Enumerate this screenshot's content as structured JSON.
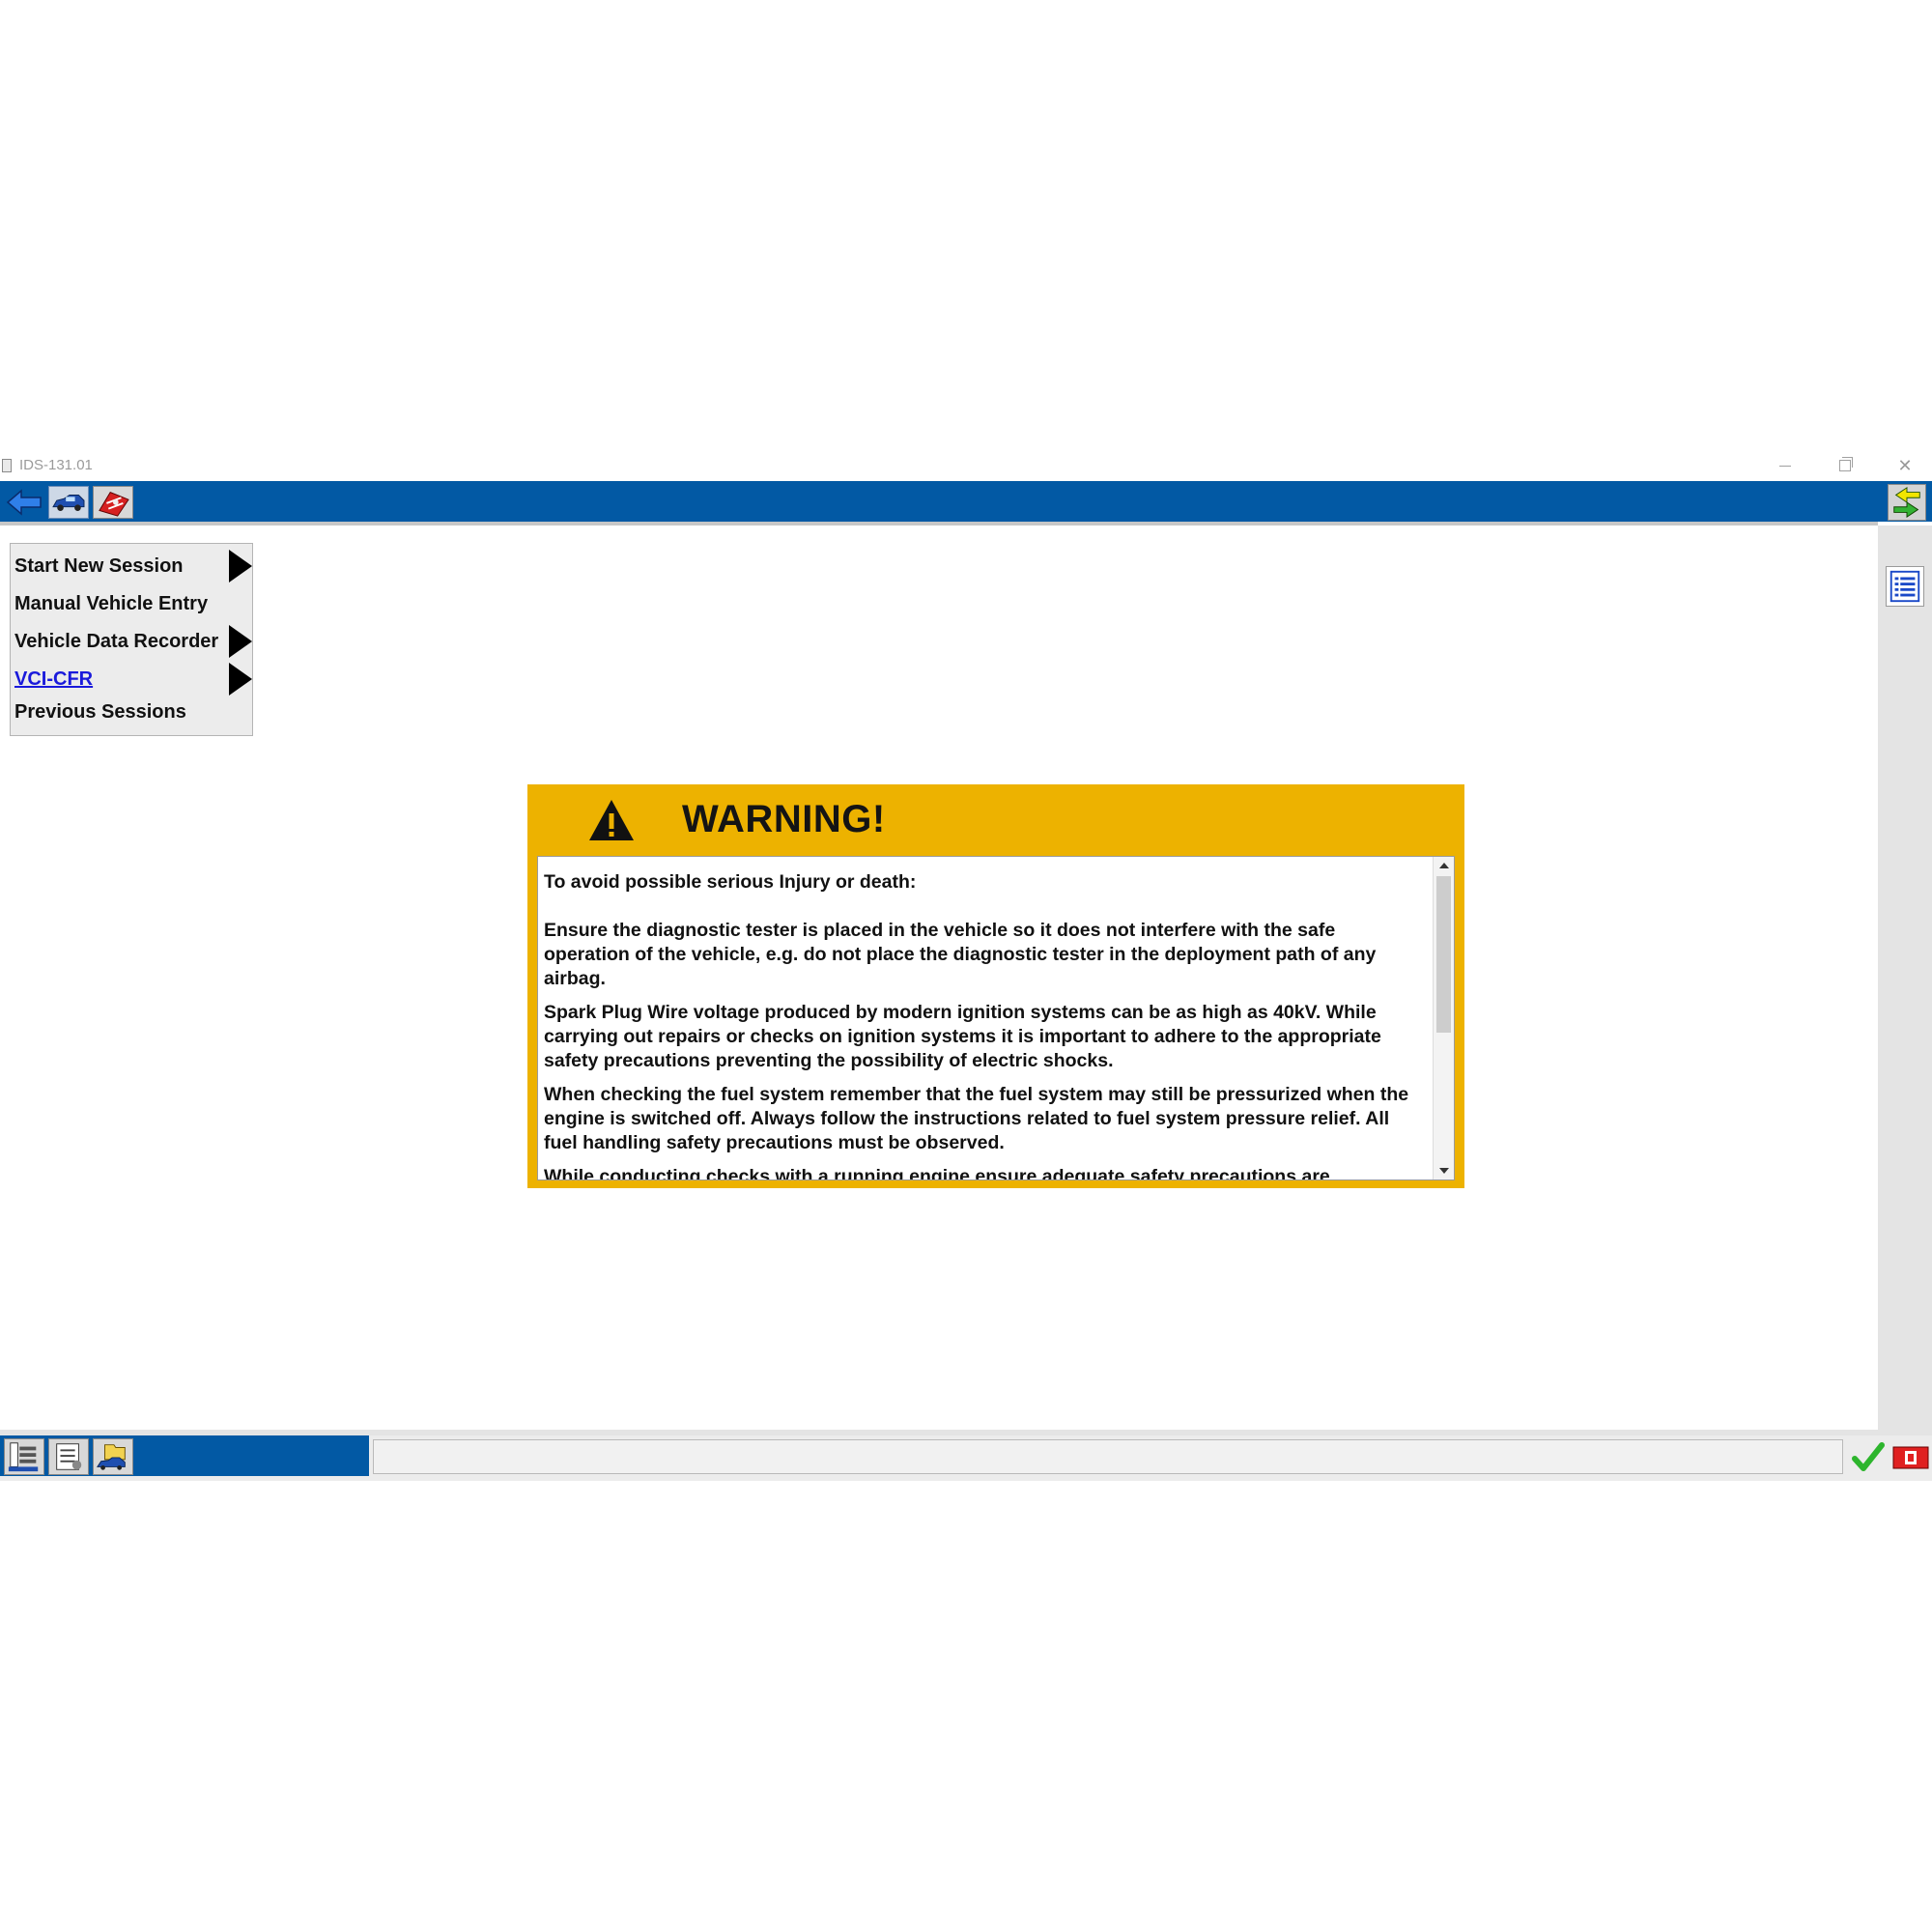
{
  "window": {
    "title": "IDS-131.01"
  },
  "toolbar": {
    "icons": [
      "back-arrow-icon",
      "vehicle-icon",
      "toolbox-icon",
      "swap-arrows-icon"
    ]
  },
  "sidebar": {
    "items": [
      {
        "label": "Start New Session",
        "has_submenu": true
      },
      {
        "label": "Manual Vehicle Entry",
        "has_submenu": false
      },
      {
        "label": "Vehicle Data Recorder",
        "has_submenu": true
      },
      {
        "label": "VCI-CFR",
        "has_submenu": true,
        "is_link": true
      },
      {
        "label": "Previous Sessions",
        "has_submenu": false
      }
    ]
  },
  "warning": {
    "title": "WARNING!",
    "intro": "To avoid possible serious Injury or death:",
    "paragraphs": [
      "Ensure the diagnostic tester is placed in the vehicle so it does not interfere with the safe operation of the vehicle, e.g. do not place the diagnostic tester in the deployment path of any airbag.",
      "Spark Plug Wire voltage produced by modern ignition systems can be as high as 40kV. While carrying out repairs or checks on ignition systems it is important to adhere to the appropriate safety precautions preventing the possibility of electric shocks.",
      "When checking the fuel system remember that the fuel system may still be pressurized when the engine is switched off. Always follow the instructions related to fuel system pressure relief. All fuel handling safety precautions must be observed.",
      "While conducting checks with a running engine ensure adequate safety precautions are"
    ]
  },
  "colors": {
    "toolbar_blue": "#0259a4",
    "warning_yellow": "#edb200",
    "link_blue": "#1a1adb",
    "status_ok_green": "#2db52d"
  }
}
